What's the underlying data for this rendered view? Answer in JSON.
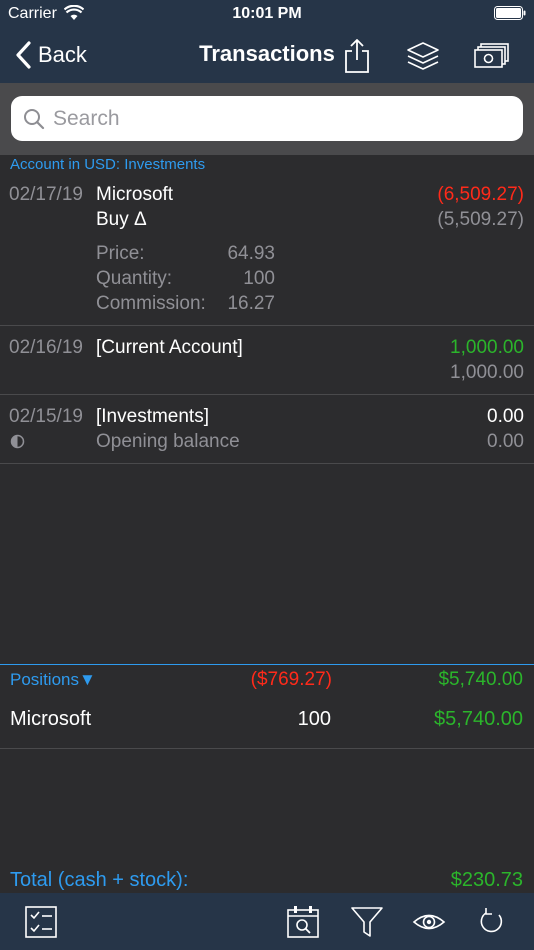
{
  "status_bar": {
    "carrier": "Carrier",
    "time": "10:01 PM"
  },
  "nav": {
    "back_label": "Back",
    "title": "Transactions"
  },
  "search": {
    "placeholder": "Search",
    "value": ""
  },
  "account_header": "Account in USD: Investments",
  "transactions": [
    {
      "date": "02/17/19",
      "payee": "Microsoft",
      "action": "Buy Δ",
      "amount": "(6,509.27)",
      "balance": "(5,509.27)",
      "details": [
        {
          "label": "Price:",
          "value": "64.93"
        },
        {
          "label": "Quantity:",
          "value": "100"
        },
        {
          "label": "Commission:",
          "value": "16.27"
        }
      ]
    },
    {
      "date": "02/16/19",
      "payee": "[Current Account]",
      "amount": "1,000.00",
      "balance": "1,000.00"
    },
    {
      "date": "02/15/19",
      "payee": "[Investments]",
      "memo": "Opening balance",
      "amount": "0.00",
      "balance": "0.00"
    }
  ],
  "positions": {
    "label": "Positions▼",
    "gain": "($769.27)",
    "value": "$5,740.00",
    "items": [
      {
        "name": "Microsoft",
        "quantity": "100",
        "value": "$5,740.00"
      }
    ]
  },
  "total": {
    "label": "Total (cash + stock):",
    "value": "$230.73"
  },
  "colors": {
    "accent": "#2e9bef",
    "negative": "#ff2a1a",
    "positive": "#2bb52b",
    "bar": "#263548"
  },
  "icons": {
    "nav": [
      "share-icon",
      "layers-icon",
      "cash-icon"
    ],
    "toolbar": [
      "checklist-icon",
      "calendar-search-icon",
      "filter-icon",
      "eye-icon",
      "refresh-icon"
    ]
  }
}
